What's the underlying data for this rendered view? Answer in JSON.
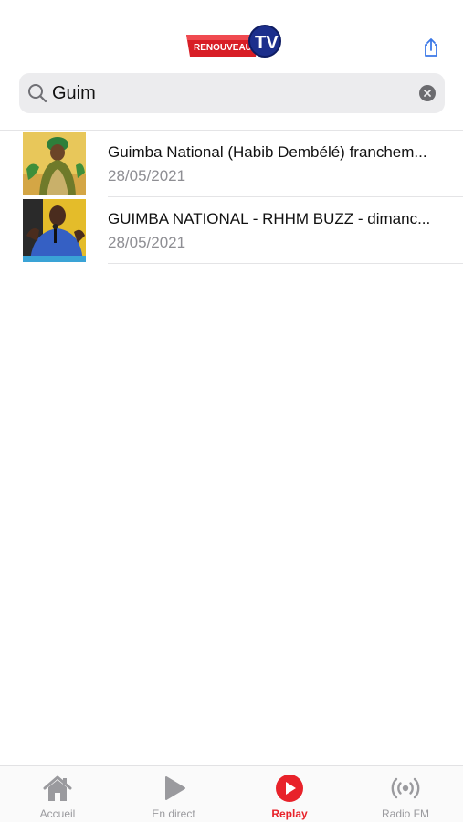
{
  "header": {
    "logo_text": "RENOUVEAU",
    "logo_badge": "TV"
  },
  "search": {
    "value": "Guim",
    "placeholder": ""
  },
  "results": [
    {
      "title": "Guimba National (Habib Dembélé) franchem...",
      "date": "28/05/2021"
    },
    {
      "title": "GUIMBA NATIONAL - RHHM BUZZ - dimanc...",
      "date": "28/05/2021"
    }
  ],
  "tabbar": {
    "tabs": [
      {
        "label": "Accueil",
        "icon": "home-icon",
        "active": false
      },
      {
        "label": "En direct",
        "icon": "play-icon",
        "active": false
      },
      {
        "label": "Replay",
        "icon": "replay-icon",
        "active": true
      },
      {
        "label": "Radio FM",
        "icon": "radio-icon",
        "active": false
      }
    ]
  },
  "colors": {
    "accent": "#e8222a",
    "logo_blue": "#1c2f8c",
    "inactive": "#9a9a9e"
  }
}
